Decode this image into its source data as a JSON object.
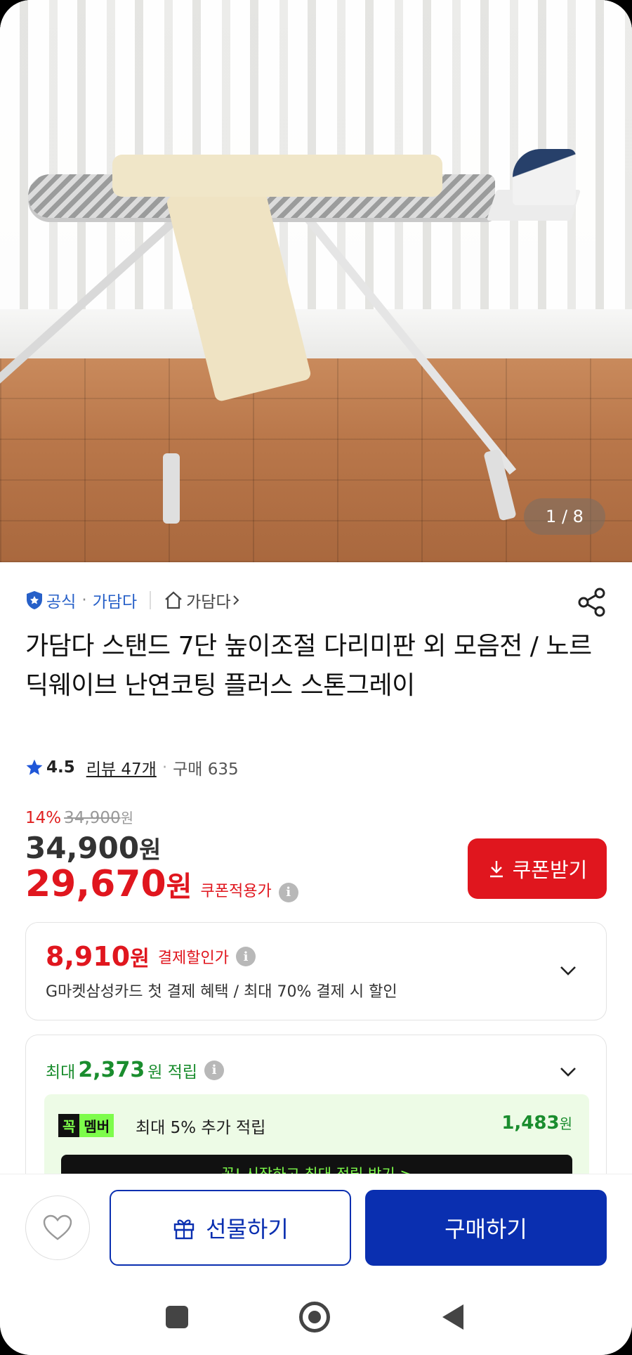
{
  "gallery": {
    "counter": "1 / 8"
  },
  "seller": {
    "badge": "공식",
    "dot": "·",
    "name": "가담다",
    "store_link": "가담다"
  },
  "product": {
    "title": "가담다 스탠드 7단 높이조절 다리미판 외 모음전 / 노르딕웨이브 난연코팅 플러스 스톤그레이"
  },
  "rating": {
    "score": "4.5",
    "review": "리뷰 47개",
    "dot": "·",
    "purchases": "구매 635"
  },
  "price": {
    "discount_pct": "14%",
    "discount_orig": "34,900",
    "discount_won": "원",
    "original": "34,900",
    "original_won": "원",
    "sale": "29,670",
    "sale_won": "원",
    "sale_label": "쿠폰적용가"
  },
  "coupon_button": "쿠폰받기",
  "payment_discount": {
    "amount": "8,910",
    "won": "원",
    "label": "결제할인가",
    "desc": "G마켓삼성카드 첫 결제 혜택 / 최대 70% 결제 시 할인"
  },
  "points": {
    "prefix": "최대",
    "amount": "2,373",
    "suffix": "원 적립",
    "member_badge_1": "꼭",
    "member_badge_2": "멤버",
    "member_text": "최대 5% 추가 적립",
    "member_points": "1,483",
    "member_won": "원",
    "member_cta": "꼭! 시작하고 최대 적립 받기 >"
  },
  "bottom": {
    "gift": "선물하기",
    "buy": "구매하기"
  },
  "colors": {
    "accent_red": "#e0161e",
    "primary_blue": "#0a2fb0",
    "link_blue": "#2760c8",
    "points_green": "#1a8d2e"
  }
}
